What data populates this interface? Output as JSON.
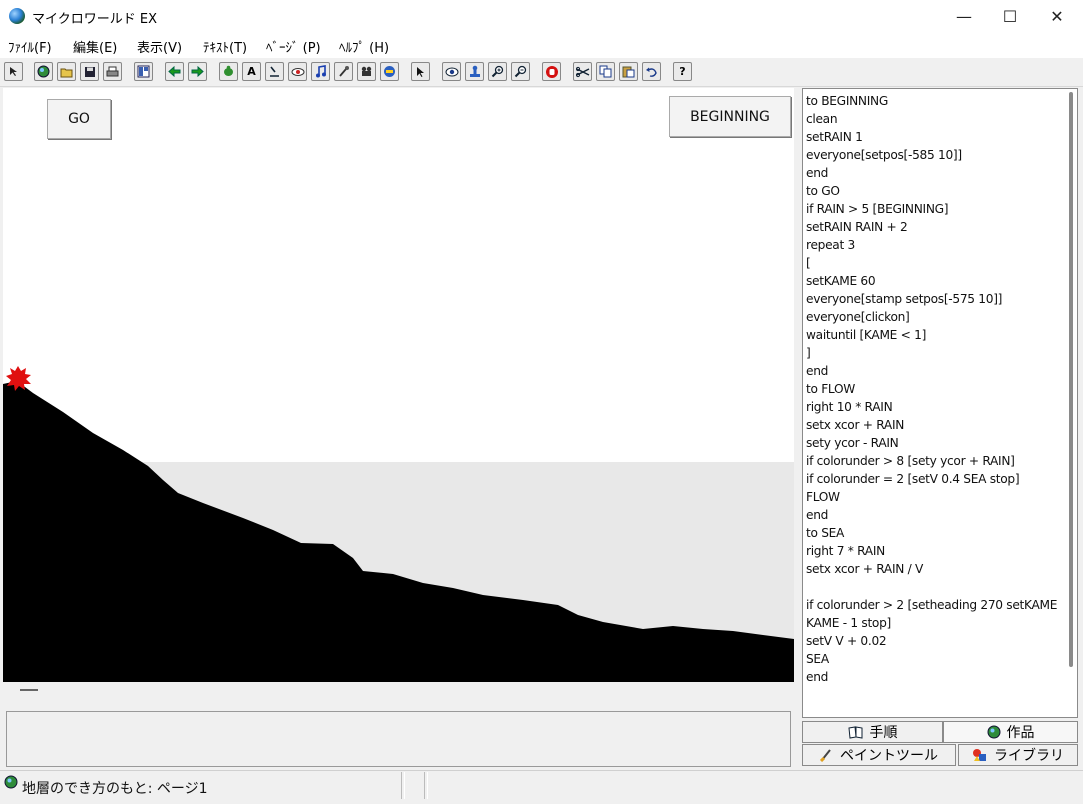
{
  "window": {
    "title": "マイクロワールド EX",
    "minimize": "—",
    "maximize": "☐",
    "close": "✕"
  },
  "menu": [
    "ﾌｧｲﾙ(F)",
    "編集(E)",
    "表示(V)",
    "ﾃｷｽﾄ(T)",
    "ﾍﾞｰｼﾞ (P)",
    "ﾍﾙﾌﾟ (H)"
  ],
  "toolbar": {
    "buttons": [
      "cursor-arrow-icon",
      "globe-icon",
      "open-folder-icon",
      "save-disk-icon",
      "print-icon",
      "page-layout-icon",
      "back-arrow-icon",
      "forward-arrow-icon",
      "turtle-hatch-icon",
      "text-box-icon",
      "button-tool-icon",
      "slider-icon",
      "music-note-icon",
      "microphone-icon",
      "video-icon",
      "robot-icon",
      "pointer-icon",
      "eye-icon",
      "stamp-icon",
      "zoom-in-icon",
      "zoom-out-icon",
      "stop-hand-icon",
      "cut-icon",
      "copy-icon",
      "paste-icon",
      "undo-icon",
      "help-icon"
    ],
    "text_tool_label": "A",
    "help_label": "?"
  },
  "canvas": {
    "buttons": {
      "go": "GO",
      "beginning": "BEGINNING"
    },
    "colors": {
      "ground": "#000000",
      "sea": "#e8e8e8",
      "turtle": "#e01010"
    }
  },
  "code": {
    "lines": [
      "to BEGINNING",
      "clean",
      "setRAIN 1",
      "everyone[setpos[-585 10]]",
      "end",
      "to GO",
      "if RAIN > 5 [BEGINNING]",
      "setRAIN RAIN + 2",
      "repeat 3",
      "[",
      "setKAME 60",
      "everyone[stamp setpos[-575 10]]",
      "everyone[clickon]",
      "waituntil [KAME < 1]",
      "]",
      "end",
      "to FLOW",
      "right 10 * RAIN",
      "setx xcor + RAIN",
      "sety ycor - RAIN",
      "if colorunder > 8 [sety ycor + RAIN]",
      "if colorunder = 2 [setV 0.4 SEA stop]",
      "FLOW",
      "end",
      "to SEA",
      "right 7 * RAIN",
      "setx xcor + RAIN /  V",
      "",
      "if colorunder > 2 [setheading 270 setKAME",
      "KAME - 1 stop]",
      "setV V + 0.02",
      "SEA",
      "end"
    ]
  },
  "tabs": {
    "procedures": "手順",
    "works": "作品",
    "paint_tools": "ペイントツール",
    "library": "ライブラリ"
  },
  "status": {
    "page_text": "地層のでき方のもと: ページ1"
  }
}
